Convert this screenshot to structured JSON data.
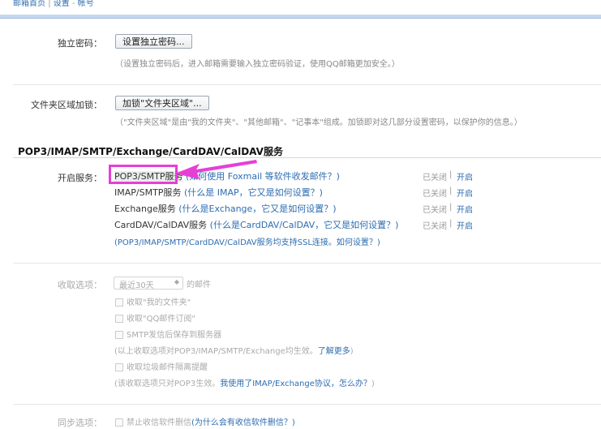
{
  "breadcrumb": {
    "home": "邮箱首页",
    "sep1": "|",
    "settings": "设置",
    "sep2": "-",
    "current": "帐号"
  },
  "independent_password": {
    "label": "独立密码：",
    "button": "设置独立密码...",
    "hint": "（设置独立密码后，进入邮箱需要输入独立密码验证，使用QQ邮箱更加安全。）"
  },
  "folder_lock": {
    "label": "文件夹区域加锁：",
    "button": "加锁\"文件夹区域\"...",
    "hint": "（\"文件夹区域\"是由\"我的文件夹\"、\"其他邮箱\"、\"记事本\"组成。加锁即对这几部分设置密码，以保护你的信息。）"
  },
  "section": {
    "title": "POP3/IMAP/SMTP/Exchange/CardDAV/CalDAV服务"
  },
  "services": {
    "label": "开启服务：",
    "items": [
      {
        "name": "POP3/SMTP服务",
        "help": "如何使用 Foxmail 等软件收发邮件？",
        "open_paren": "(",
        "close_paren": ")",
        "status": "已关闭",
        "sep": "|",
        "action": "开启"
      },
      {
        "name": "IMAP/SMTP服务",
        "help": "什么是 IMAP，它又是如何设置？",
        "open_paren": "(",
        "close_paren": ")",
        "status": "已关闭",
        "sep": "|",
        "action": "开启"
      },
      {
        "name": "Exchange服务",
        "help": "什么是Exchange，它又是如何设置？",
        "open_paren": "(",
        "close_paren": ")",
        "status": "已关闭",
        "sep": "|",
        "action": "开启"
      },
      {
        "name": "CardDAV/CalDAV服务",
        "help": "什么是CardDAV/CalDAV，它又是如何设置？",
        "open_paren": "(",
        "close_paren": ")",
        "status": "已关闭",
        "sep": "|",
        "action": "开启"
      }
    ],
    "ssl_note_prefix": "(POP3/IMAP/SMTP/CardDAV/CalDAV服务均支持SSL连接。",
    "ssl_note_link": "如何设置？",
    "ssl_note_suffix": ")"
  },
  "receive": {
    "label": "收取选项：",
    "select_value": "最近30天",
    "select_suffix": "的邮件",
    "options": [
      "收取\"我的文件夹\"",
      "收取\"QQ邮件订阅\"",
      "SMTP发信后保存到服务器"
    ],
    "note1_prefix": "(以上收取选项对POP3/IMAP/SMTP/Exchange均生效。",
    "note1_link": "了解更多",
    "note1_suffix": ")",
    "spam_option": "收取垃圾邮件隔离提醒",
    "note2_prefix": "(该收取选项只对POP3生效。",
    "note2_link": "我使用了IMAP/Exchange协议，怎么办？",
    "note2_suffix": ")"
  },
  "sync": {
    "label": "同步选项：",
    "option": "禁止收信软件删信",
    "link": "为什么会有收信软件删信？",
    "open_paren": "(",
    "close_paren": ")"
  },
  "colors": {
    "highlight": "#e63fd6",
    "link": "#2d6db0"
  }
}
